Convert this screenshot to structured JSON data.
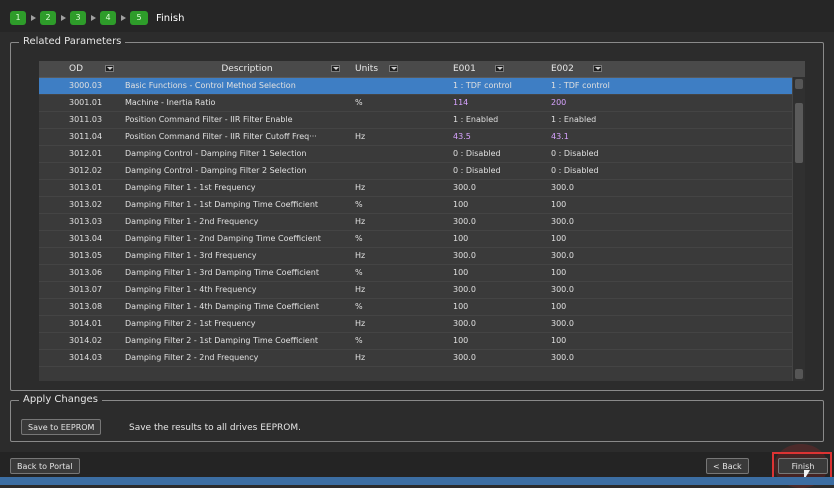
{
  "wizard": {
    "steps": [
      "1",
      "2",
      "3",
      "4",
      "5"
    ],
    "current_label": "Finish"
  },
  "related_parameters": {
    "title": "Related Parameters",
    "columns": {
      "od": "OD",
      "description": "Description",
      "units": "Units",
      "e001": "E001",
      "e002": "E002"
    },
    "rows": [
      {
        "od": "3000.03",
        "description": "Basic Functions - Control Method Selection",
        "units": "",
        "e001": "1 : TDF control",
        "e002": "1 : TDF control",
        "selected": true
      },
      {
        "od": "3001.01",
        "description": "Machine - Inertia Ratio",
        "units": "%",
        "e001": "114",
        "e002": "200",
        "highlight": true
      },
      {
        "od": "3011.03",
        "description": "Position Command Filter - IIR Filter Enable",
        "units": "",
        "e001": "1 : Enabled",
        "e002": "1 : Enabled"
      },
      {
        "od": "3011.04",
        "description": "Position Command Filter - IIR Filter Cutoff Freq···",
        "units": "Hz",
        "e001": "43.5",
        "e002": "43.1",
        "highlight": true
      },
      {
        "od": "3012.01",
        "description": "Damping Control - Damping Filter 1 Selection",
        "units": "",
        "e001": "0 : Disabled",
        "e002": "0 : Disabled"
      },
      {
        "od": "3012.02",
        "description": "Damping Control - Damping Filter 2 Selection",
        "units": "",
        "e001": "0 : Disabled",
        "e002": "0 : Disabled"
      },
      {
        "od": "3013.01",
        "description": "Damping Filter 1 - 1st Frequency",
        "units": "Hz",
        "e001": "300.0",
        "e002": "300.0"
      },
      {
        "od": "3013.02",
        "description": "Damping Filter 1 - 1st Damping Time Coefficient",
        "units": "%",
        "e001": "100",
        "e002": "100"
      },
      {
        "od": "3013.03",
        "description": "Damping Filter 1 - 2nd Frequency",
        "units": "Hz",
        "e001": "300.0",
        "e002": "300.0"
      },
      {
        "od": "3013.04",
        "description": "Damping Filter 1 - 2nd Damping Time Coefficient",
        "units": "%",
        "e001": "100",
        "e002": "100"
      },
      {
        "od": "3013.05",
        "description": "Damping Filter 1 - 3rd Frequency",
        "units": "Hz",
        "e001": "300.0",
        "e002": "300.0"
      },
      {
        "od": "3013.06",
        "description": "Damping Filter 1 - 3rd Damping Time Coefficient",
        "units": "%",
        "e001": "100",
        "e002": "100"
      },
      {
        "od": "3013.07",
        "description": "Damping Filter 1 - 4th Frequency",
        "units": "Hz",
        "e001": "300.0",
        "e002": "300.0"
      },
      {
        "od": "3013.08",
        "description": "Damping Filter 1 - 4th Damping Time Coefficient",
        "units": "%",
        "e001": "100",
        "e002": "100"
      },
      {
        "od": "3014.01",
        "description": "Damping Filter 2 - 1st Frequency",
        "units": "Hz",
        "e001": "300.0",
        "e002": "300.0"
      },
      {
        "od": "3014.02",
        "description": "Damping Filter 2 - 1st Damping Time Coefficient",
        "units": "%",
        "e001": "100",
        "e002": "100"
      },
      {
        "od": "3014.03",
        "description": "Damping Filter 2 - 2nd Frequency",
        "units": "Hz",
        "e001": "300.0",
        "e002": "300.0"
      }
    ]
  },
  "apply_changes": {
    "title": "Apply Changes",
    "save_button": "Save to EEPROM",
    "description": "Save the results to all drives EEPROM."
  },
  "footer": {
    "back_to_portal": "Back to Portal",
    "back": "< Back",
    "finish": "Finish"
  },
  "colors": {
    "selected_row": "#3e7ec4",
    "highlight_value": "#d7a3ff",
    "step_green": "#2e9c2a"
  }
}
